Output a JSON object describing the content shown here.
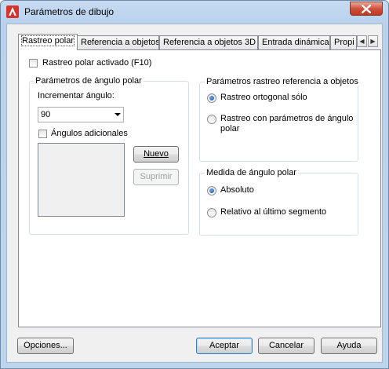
{
  "window": {
    "title": "Parámetros de dibujo"
  },
  "tabs": [
    {
      "label": "Rastreo polar"
    },
    {
      "label": "Referencia a objetos"
    },
    {
      "label": "Referencia a objetos 3D"
    },
    {
      "label": "Entrada dinámica"
    },
    {
      "label": "Propi"
    }
  ],
  "polar": {
    "enable_label": "Rastreo polar activado (F10)",
    "angle_group_title": "Parámetros de ángulo polar",
    "increment_label": "Incrementar ángulo:",
    "increment_value": "90",
    "additional_label": "Ángulos adicionales",
    "new_button": "Nuevo",
    "delete_button": "Suprimir"
  },
  "tracking": {
    "group_title": "Parámetros rastreo referencia a objetos",
    "option1": "Rastreo ortogonal sólo",
    "option2_line1": "Rastreo con parámetros de ángulo",
    "option2_line2": "polar"
  },
  "measure": {
    "group_title": "Medida de ángulo polar",
    "option1": "Absoluto",
    "option2": "Relativo al último segmento"
  },
  "footer": {
    "options_button": "Opciones...",
    "ok_button": "Aceptar",
    "cancel_button": "Cancelar",
    "help_button": "Ayuda"
  },
  "icons": {
    "app": "autocad-logo-icon",
    "close": "close-icon"
  }
}
